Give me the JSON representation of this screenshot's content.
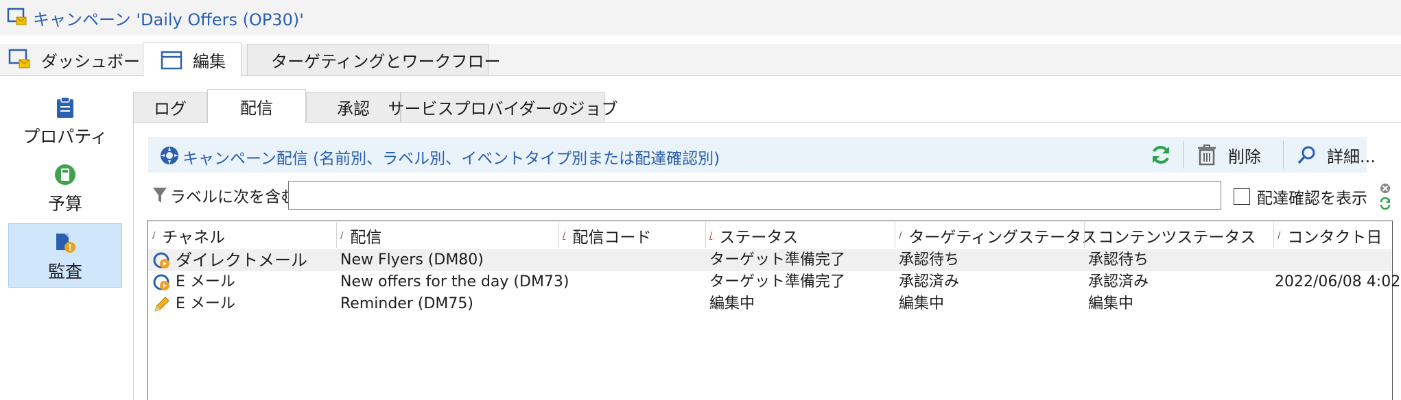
{
  "window": {
    "title": "キャンペーン 'Daily Offers (OP30)'"
  },
  "top_tabs": [
    {
      "label": "ダッシュボード"
    },
    {
      "label": "編集"
    },
    {
      "label": "ターゲティングとワークフロー"
    }
  ],
  "side_nav": [
    {
      "label": "プロパティ"
    },
    {
      "label": "予算"
    },
    {
      "label": "監査"
    }
  ],
  "sub_tabs": [
    {
      "label": "ログ"
    },
    {
      "label": "配信"
    },
    {
      "label": "承認"
    },
    {
      "label": "サービスプロバイダーのジョブ"
    }
  ],
  "toolbar": {
    "title": "キャンペーン配信 (名前別、ラベル別、イベントタイプ別または配達確認別)",
    "delete_label": "削除",
    "details_label": "詳細..."
  },
  "filter": {
    "label": "ラベルに次を含む:",
    "value": "",
    "show_confirm_label": "配達確認を表示"
  },
  "table": {
    "columns": [
      "チャネル",
      "配信",
      "配信コード",
      "ステータス",
      "ターゲティングステータス",
      "コンテンツステータス",
      "コンタクト日"
    ],
    "rows": [
      {
        "channel": "ダイレクトメール",
        "delivery": "New Flyers (DM80)",
        "code": "",
        "status": "ターゲット準備完了",
        "targeting_status": "承認待ち",
        "content_status": "承認待ち",
        "contact_date": ""
      },
      {
        "channel": "E メール",
        "delivery": "New offers for the day (DM73)",
        "code": "",
        "status": "ターゲット準備完了",
        "targeting_status": "承認済み",
        "content_status": "承認済み",
        "contact_date": "2022/06/08 4:02"
      },
      {
        "channel": "E メール",
        "delivery": "Reminder (DM75)",
        "code": "",
        "status": "編集中",
        "targeting_status": "編集中",
        "content_status": "編集中",
        "contact_date": ""
      }
    ]
  },
  "colors": {
    "accent": "#2a60b0",
    "selected_bg": "#cfe6fb",
    "toolbar_bg": "#eaf2fa",
    "refresh_green": "#2aa34a"
  }
}
